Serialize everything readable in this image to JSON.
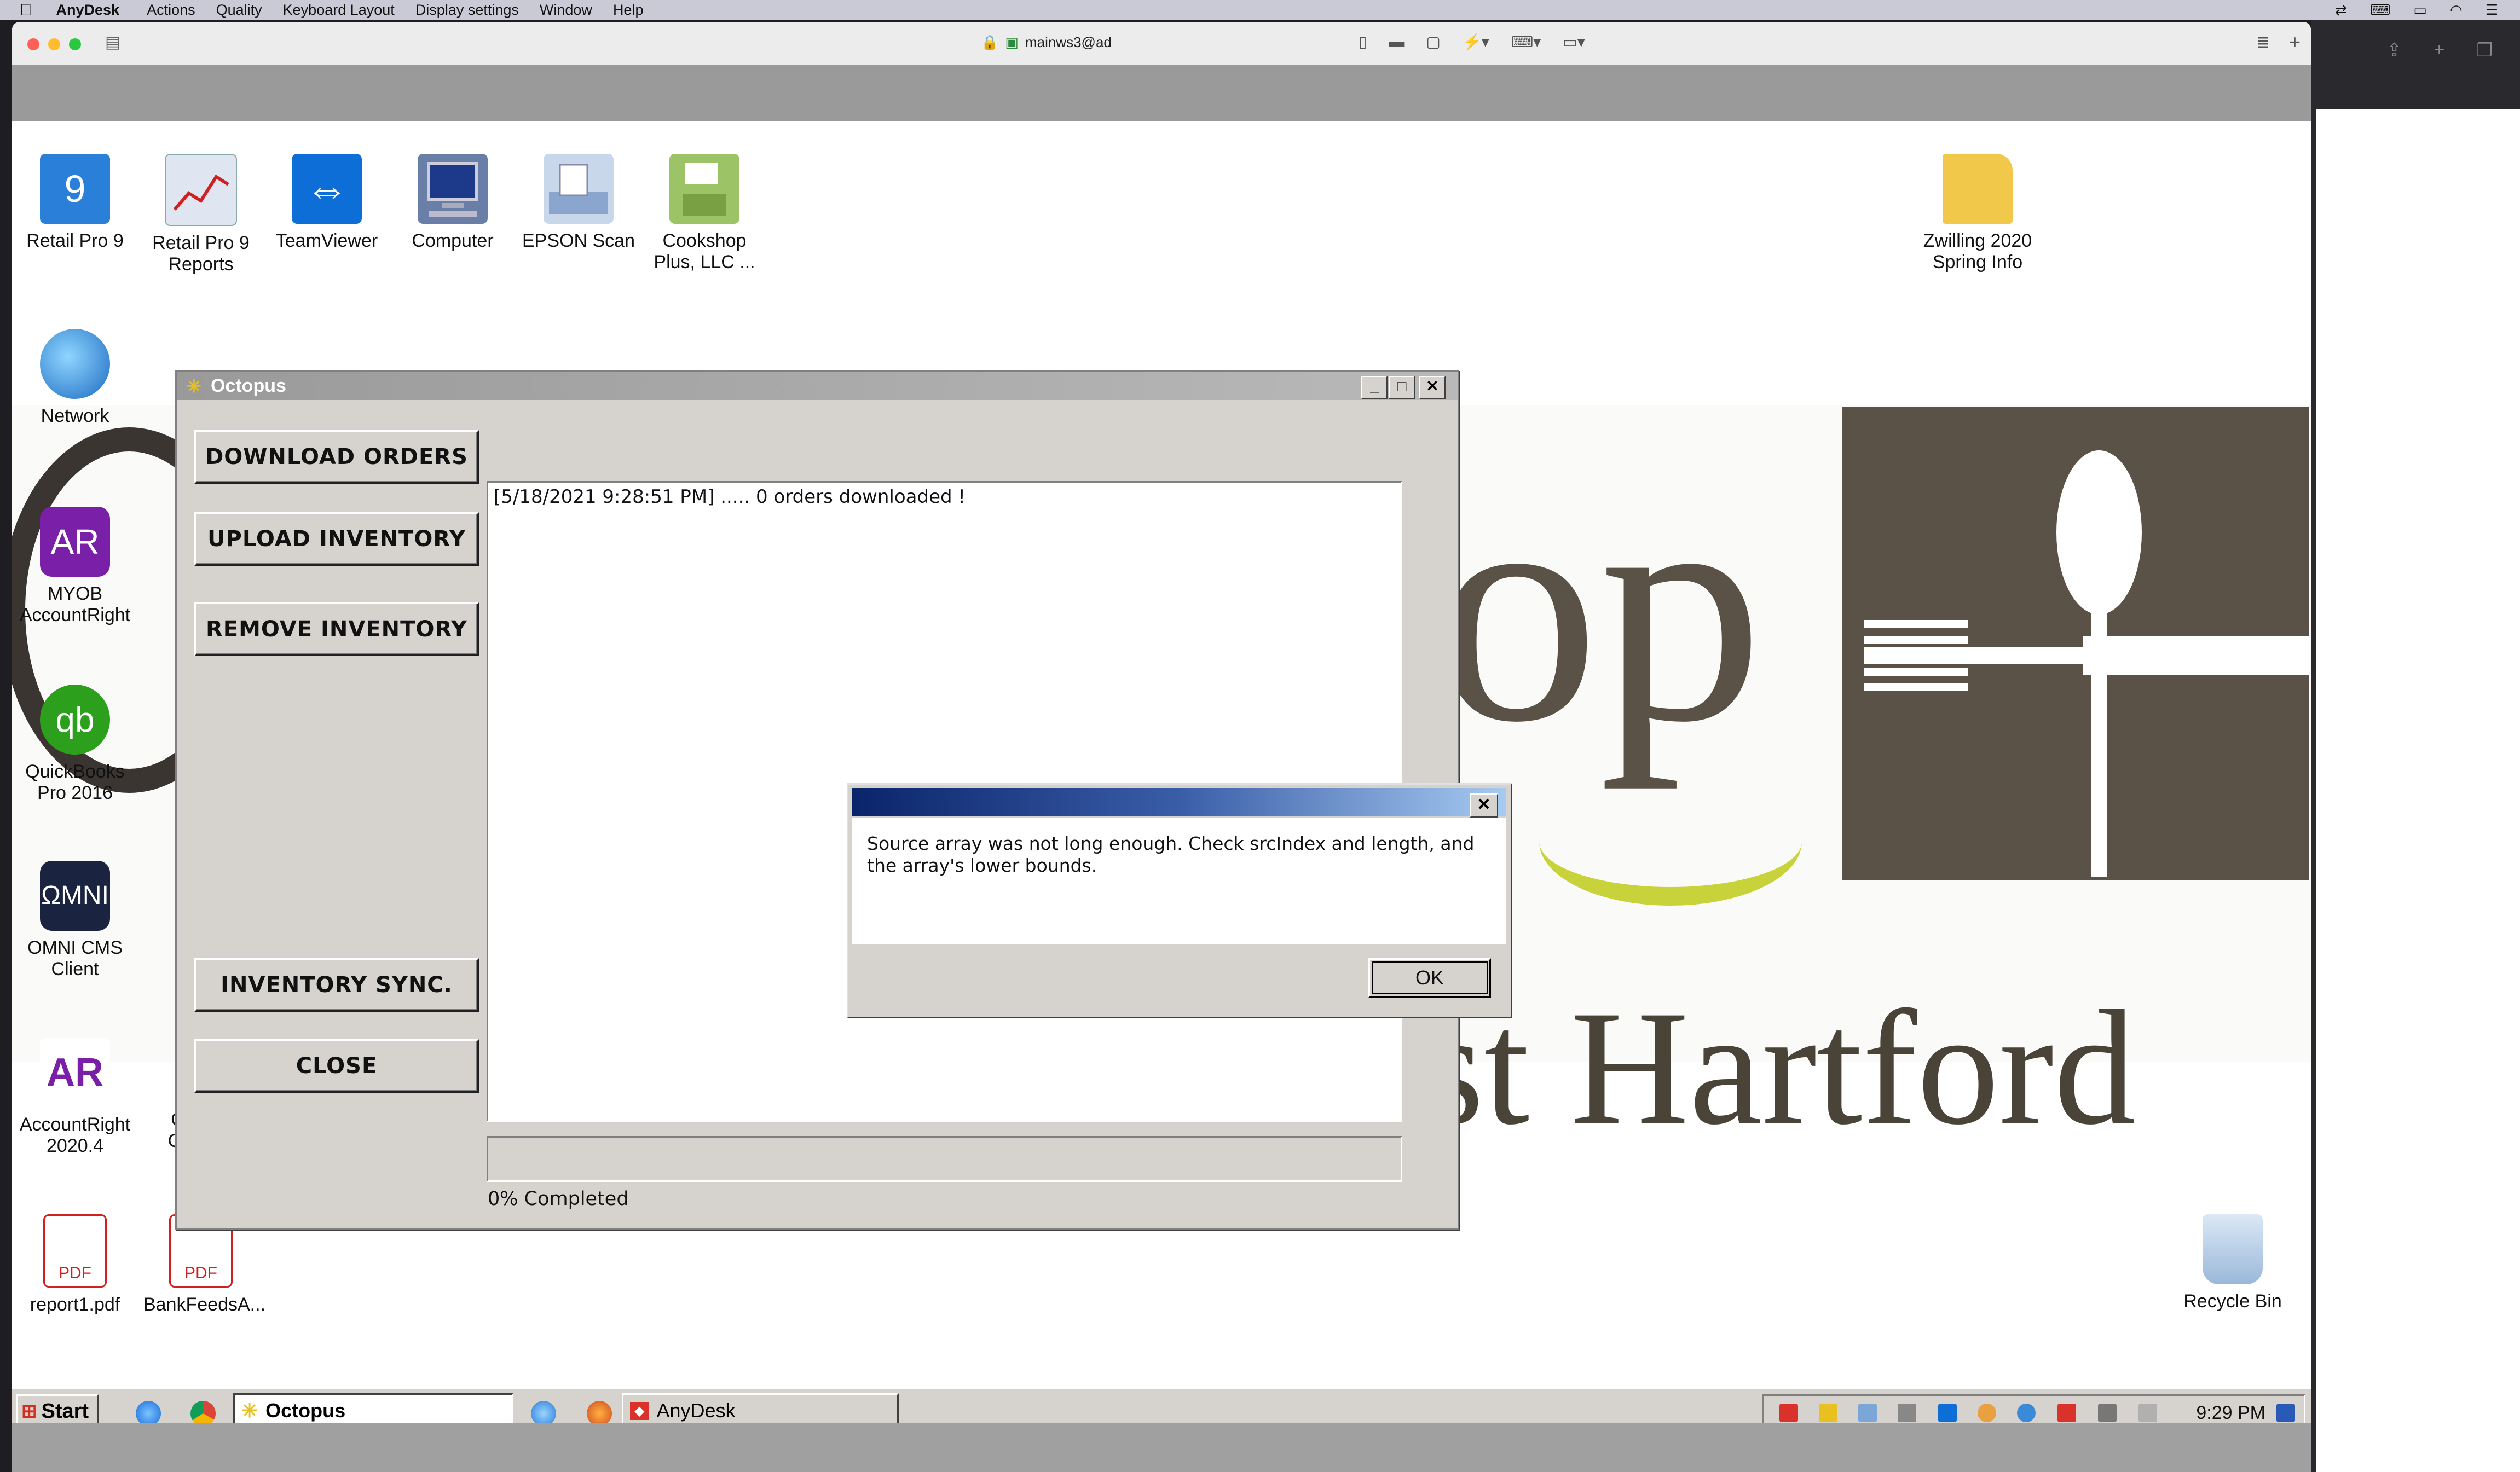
{
  "mac_menubar": {
    "app": "AnyDesk",
    "items": [
      "Actions",
      "Quality",
      "Keyboard Layout",
      "Display settings",
      "Window",
      "Help"
    ]
  },
  "anydesk": {
    "title": "mainws3@ad",
    "window_icons": [
      "lock-icon",
      "monitor-icon",
      "chat-icon",
      "clipboard-icon",
      "lightning-icon",
      "keyboard-icon",
      "screen-icon",
      "menu-icon",
      "add-tab-icon"
    ]
  },
  "desktop": {
    "icons": [
      {
        "label": "Retail Pro 9",
        "icon": "retail-pro-icon",
        "color": "#2a7fd8"
      },
      {
        "label": "Retail Pro 9 Reports",
        "icon": "reports-icon",
        "color": "#c8d4e8"
      },
      {
        "label": "TeamViewer",
        "icon": "teamviewer-icon",
        "color": "#0e6ed8"
      },
      {
        "label": "Computer",
        "icon": "computer-icon",
        "color": "#6a7fa8"
      },
      {
        "label": "EPSON Scan",
        "icon": "scanner-icon",
        "color": "#8aa6cf"
      },
      {
        "label": "Cookshop Plus, LLC ...",
        "icon": "floppy-icon",
        "color": "#9cc466"
      },
      {
        "label": "Zwilling 2020 Spring Info",
        "icon": "folder-icon",
        "color": "#f2c84a"
      },
      {
        "label": "Network",
        "icon": "network-icon",
        "color": "#3a8ad8"
      },
      {
        "label": "MYOB AccountRight",
        "icon": "myob-icon",
        "color": "#7a1fa8"
      },
      {
        "label": "QuickBooks Pro 2016",
        "icon": "quickbooks-icon",
        "color": "#2ca01c"
      },
      {
        "label": "OMNI CMS Client",
        "icon": "omni-icon",
        "color": "#1a2440"
      },
      {
        "label": "AccountRight 2020.4",
        "icon": "accountright-icon",
        "color": "#7a1fa8"
      },
      {
        "label": "Google Chrome",
        "icon": "chrome-icon",
        "color": "#e8e8e8"
      },
      {
        "label": "report1.pdf",
        "icon": "pdf-icon",
        "color": "#d02020"
      },
      {
        "label": "BankFeedsA...",
        "icon": "pdf-icon",
        "color": "#d02020"
      },
      {
        "label": "Recycle Bin",
        "icon": "recycle-bin-icon",
        "color": "#a8c4e0"
      }
    ],
    "wallpaper": {
      "text_op": "op",
      "text_hartford": "West Hartford",
      "accent": "#5a5246"
    }
  },
  "octopus": {
    "title": "Octopus",
    "buttons": {
      "download": "DOWNLOAD ORDERS",
      "upload": "UPLOAD INVENTORY",
      "remove": "REMOVE INVENTORY",
      "sync": "INVENTORY SYNC.",
      "close": "CLOSE"
    },
    "log_line": "[5/18/2021 9:28:51 PM] ..... 0 orders downloaded !",
    "progress_text": "0% Completed",
    "progress_value": 0
  },
  "dialog": {
    "message": "Source array was not long enough. Check srcIndex and length, and the array's lower bounds.",
    "ok": "OK",
    "close": "✕"
  },
  "taskbar": {
    "start": "Start",
    "tasks": [
      {
        "label": "Octopus",
        "active": true
      },
      {
        "label": "AnyDesk",
        "active": false
      }
    ],
    "clock": "9:29 PM"
  }
}
